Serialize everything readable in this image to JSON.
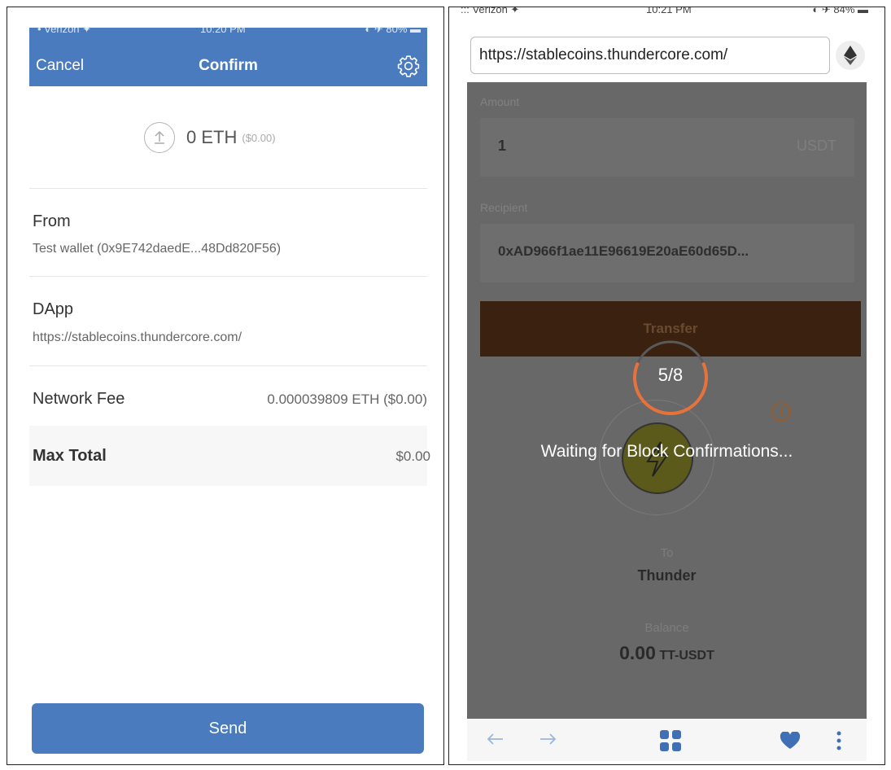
{
  "left": {
    "header": {
      "cancel_label": "Cancel",
      "title": "Confirm",
      "settings_icon": "gear-icon",
      "background": "#4a7bbf"
    },
    "amount": {
      "value": "0 ETH",
      "usd": "($0.00)",
      "icon": "upload-arrow-icon"
    },
    "from": {
      "label": "From",
      "value": "Test wallet (0x9E742daedE...48Dd820F56)"
    },
    "dapp": {
      "label": "DApp",
      "value": "https://stablecoins.thundercore.com/"
    },
    "network_fee": {
      "label": "Network Fee",
      "value": "0.000039809 ETH ($0.00)"
    },
    "max_total": {
      "label": "Max Total",
      "value": "$0.00"
    },
    "send_label": "Send"
  },
  "right": {
    "url": "https://stablecoins.thundercore.com/",
    "eth_icon": "ethereum-icon",
    "amount": {
      "label": "Amount",
      "value": "1",
      "unit": "USDT"
    },
    "recipient": {
      "label": "Recipient",
      "value": "0xAD966f1ae11E96619E20aE60d65D..."
    },
    "transfer_label": "Transfer",
    "progress": {
      "text": "5/8",
      "current": 5,
      "total": 8,
      "color": "#e8733a"
    },
    "waiting_text": "Waiting for Block Confirmations...",
    "to": {
      "label": "To",
      "value": "Thunder"
    },
    "balance": {
      "label": "Balance",
      "value": "0.00",
      "unit": "TT-USDT"
    },
    "bottom_nav": [
      "back-arrow-icon",
      "forward-arrow-icon",
      "apps-grid-icon",
      "heart-icon",
      "more-vertical-icon"
    ]
  }
}
